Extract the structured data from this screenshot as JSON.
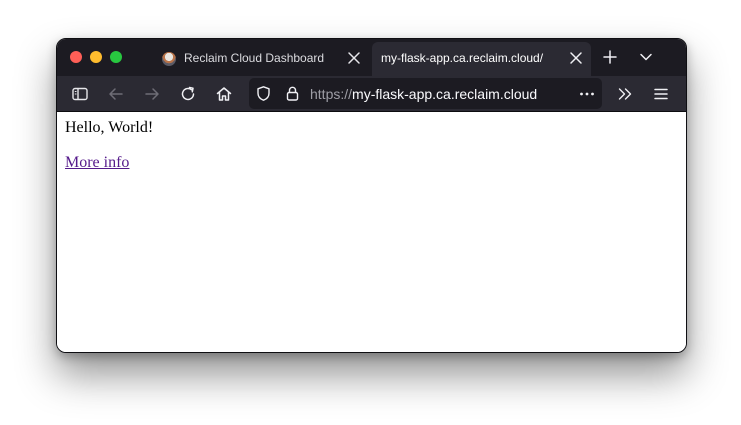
{
  "window": {
    "traffic_lights": [
      "close",
      "minimize",
      "zoom"
    ],
    "colors": {
      "close": "#fe5f57",
      "minimize": "#febc2e",
      "zoom": "#28c840"
    }
  },
  "tabs": [
    {
      "title": "Reclaim Cloud Dashboard",
      "active": false,
      "icon": "reclaim-cloud-favicon"
    },
    {
      "title": "my-flask-app.ca.reclaim.cloud/",
      "active": true
    }
  ],
  "toolbar": {
    "icons": [
      "sidebar-icon",
      "back-icon",
      "forward-icon",
      "reload-icon",
      "home-icon",
      "tracking-shield-icon",
      "lock-icon",
      "page-actions-icon",
      "overflow-icon",
      "menu-icon"
    ],
    "url": {
      "scheme": "https://",
      "host": "my-flask-app.ca.reclaim.cloud"
    }
  },
  "page": {
    "heading_text": "Hello, World!",
    "link_text": "More info"
  },
  "colors": {
    "tabbar_bg": "#1c1b22",
    "toolbar_bg": "#2b2a33",
    "link_visited": "#551a8b"
  }
}
